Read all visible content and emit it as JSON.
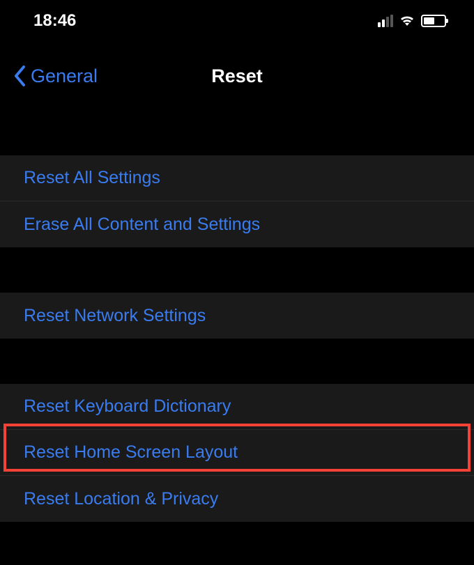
{
  "status": {
    "time": "18:46"
  },
  "nav": {
    "back_label": "General",
    "title": "Reset"
  },
  "groups": [
    {
      "items": [
        {
          "label": "Reset All Settings"
        },
        {
          "label": "Erase All Content and Settings"
        }
      ]
    },
    {
      "items": [
        {
          "label": "Reset Network Settings"
        }
      ]
    },
    {
      "items": [
        {
          "label": "Reset Keyboard Dictionary"
        },
        {
          "label": "Reset Home Screen Layout"
        },
        {
          "label": "Reset Location & Privacy"
        }
      ]
    }
  ]
}
